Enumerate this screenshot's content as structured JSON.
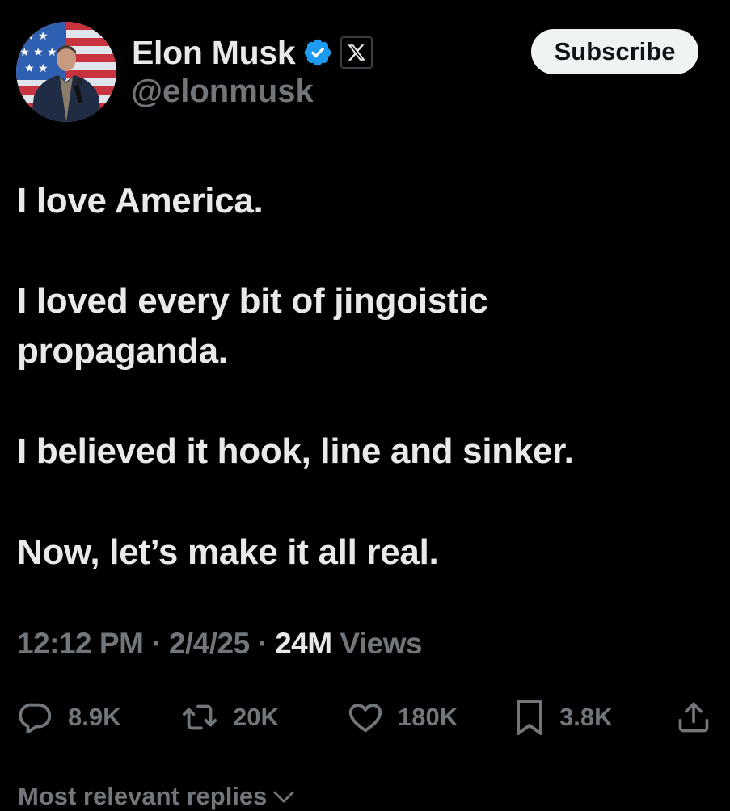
{
  "author": {
    "display_name": "Elon Musk",
    "handle": "@elonmusk",
    "verified_icon": "verified-badge-icon",
    "affiliation_icon": "x-logo-icon"
  },
  "subscribe_label": "Subscribe",
  "tweet": {
    "paragraphs": [
      "I love America.",
      "I loved every bit of jingoistic",
      "propaganda.",
      "I believed it hook, line and sinker.",
      "Now, let’s make it all real."
    ]
  },
  "meta": {
    "time": "12:12 PM",
    "separator": "·",
    "date": "2/4/25",
    "views_count": "24M",
    "views_label": "Views"
  },
  "actions": {
    "replies": "8.9K",
    "reposts": "20K",
    "likes": "180K",
    "bookmarks": "3.8K"
  },
  "replies_filter": "Most relevant replies",
  "colors": {
    "background": "#000000",
    "primary_text": "#e7e9ea",
    "secondary_text": "#71767b",
    "verified_blue": "#1d9bf0",
    "button_bg": "#eff3f4"
  }
}
